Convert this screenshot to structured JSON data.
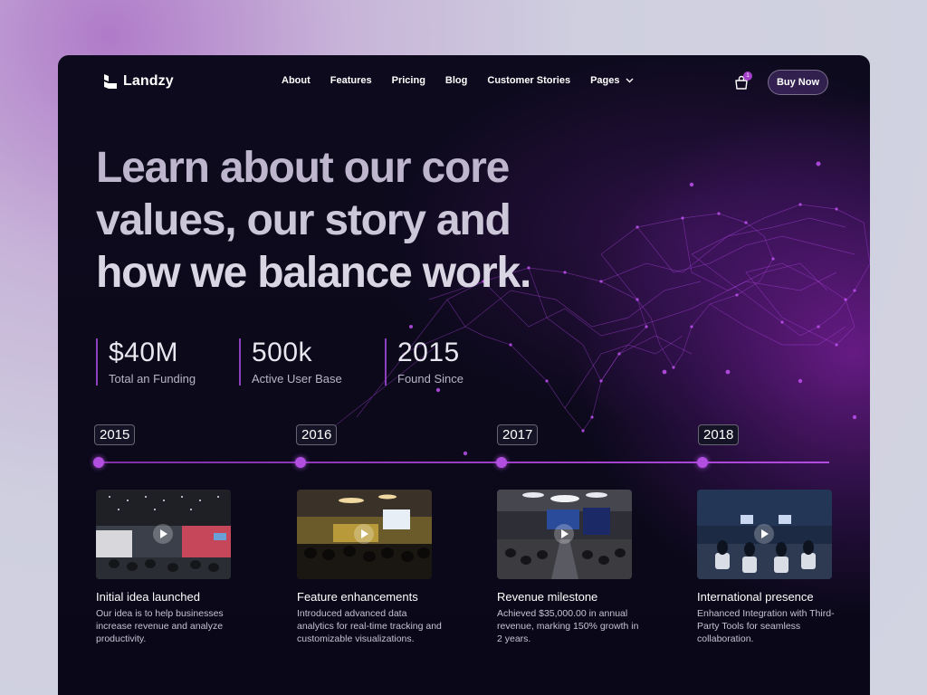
{
  "brand": {
    "name": "Landzy"
  },
  "nav": {
    "items": [
      {
        "label": "About"
      },
      {
        "label": "Features"
      },
      {
        "label": "Pricing"
      },
      {
        "label": "Blog"
      },
      {
        "label": "Customer Stories"
      },
      {
        "label": "Pages"
      }
    ],
    "cart_count": "1",
    "buy_label": "Buy Now"
  },
  "hero": {
    "line1": "Learn about our core",
    "line2": "values, our story and",
    "line3": "how we balance work."
  },
  "stats": [
    {
      "value": "$40M",
      "label": "Total an Funding"
    },
    {
      "value": "500k",
      "label": "Active User Base"
    },
    {
      "value": "2015",
      "label": "Found Since"
    }
  ],
  "timeline": [
    {
      "year": "2015",
      "title": "Initial idea launched",
      "description": "Our idea is to help businesses increase revenue and analyze productivity."
    },
    {
      "year": "2016",
      "title": "Feature enhancements",
      "description": "Introduced advanced data analytics for real-time tracking and customizable visualizations."
    },
    {
      "year": "2017",
      "title": "Revenue milestone",
      "description": "Achieved $35,000.00 in annual revenue, marking 150% growth in 2 years."
    },
    {
      "year": "2018",
      "title": "International presence",
      "description": "Enhanced Integration with Third-Party Tools for seamless collaboration."
    }
  ],
  "colors": {
    "accent": "#b24fe0",
    "background": "#0c0a1c"
  }
}
